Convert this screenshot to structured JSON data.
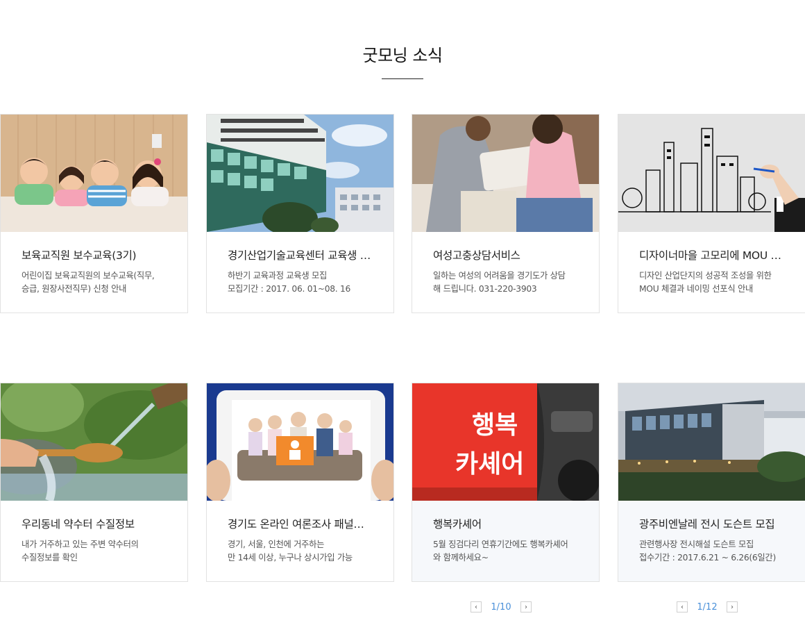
{
  "section": {
    "title": "굿모닝 소식"
  },
  "cards": [
    {
      "title": "보육교직원 보수교육(3기)",
      "desc": [
        "어린이집 보육교직원의 보수교육(직무,",
        "승급, 원장사전직무) 신청 안내"
      ]
    },
    {
      "title": "경기산업기술교육센터 교육생 모집",
      "desc": [
        "하반기 교육과정 교육생 모집",
        "모집기간 : 2017. 06. 01~08. 16"
      ]
    },
    {
      "title": "여성고충상담서비스",
      "desc": [
        "일하는 여성의 어려움을 경기도가 상담",
        "해 드립니다. 031-220-3903"
      ]
    },
    {
      "title": "디자이너마을 고모리에 MOU 및..",
      "desc": [
        "디자인 산업단지의 성공적 조성을 위한",
        "MOU 체결과 네이밍 선포식 안내"
      ]
    },
    {
      "title": "우리동네 약수터 수질정보",
      "desc": [
        "내가 거주하고 있는 주변 약수터의",
        "수질정보를 확인"
      ]
    },
    {
      "title": "경기도 온라인 여론조사 패널모집",
      "desc": [
        "경기, 서울, 인천에 거주하는",
        "만 14세 이상, 누구나 상시가입 가능"
      ]
    },
    {
      "title": "행복카셰어",
      "desc": [
        "5월 징검다리 연휴기간에도 행복카셰어",
        "와 함께하세요~"
      ]
    },
    {
      "title": "광주비엔날레 전시 도슨트 모집",
      "desc": [
        "관련행사장 전시해설 도슨트 모집",
        "접수기간 : 2017.6.21 ~ 6.26(6일간)"
      ]
    }
  ],
  "car_text": {
    "line1": "행복",
    "line2": "카셰어"
  },
  "pagers": [
    {
      "prev": "‹",
      "count": "1/10",
      "next": "›"
    },
    {
      "prev": "‹",
      "count": "1/12",
      "next": "›"
    }
  ],
  "colors": {
    "pager_count": "#4a90d9",
    "car_red": "#e8352a"
  },
  "icons": [
    "chevron-left-icon",
    "chevron-right-icon"
  ]
}
